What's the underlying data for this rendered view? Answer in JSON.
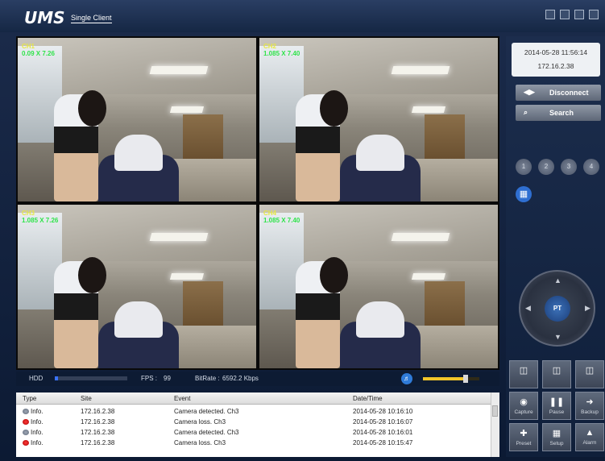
{
  "app": {
    "name": "UMS",
    "subtitle": "Single Client"
  },
  "tiles": [
    {
      "line1": "CH1",
      "line2": "0.09 X 7.26",
      "selected": true
    },
    {
      "line1": "CH2",
      "line2": "1.085 X 7.40",
      "selected": false
    },
    {
      "line1": "CH3",
      "line2": "1.085 X 7.26",
      "selected": false
    },
    {
      "line1": "CH4",
      "line2": "1.085 X 7.40",
      "selected": false
    }
  ],
  "status": {
    "hdd_label": "HDD",
    "hdd_fraction": 0.04,
    "fps_label": "FPS :",
    "fps_value": "99",
    "bitrate_label": "BitRate :",
    "bitrate_value": "6592.2 Kbps",
    "volume_fraction": 0.75
  },
  "log": {
    "headers": {
      "type": "Type",
      "site": "Site",
      "event": "Event",
      "datetime": "Date/Time"
    },
    "rows": [
      {
        "icon": "ok",
        "type": "Info.",
        "site": "172.16.2.38",
        "event": "Camera detected. Ch3",
        "datetime": "2014-05-28 10:16:10"
      },
      {
        "icon": "err",
        "type": "Info.",
        "site": "172.16.2.38",
        "event": "Camera loss. Ch3",
        "datetime": "2014-05-28 10:16:07"
      },
      {
        "icon": "ok",
        "type": "Info.",
        "site": "172.16.2.38",
        "event": "Camera detected. Ch3",
        "datetime": "2014-05-28 10:16:01"
      },
      {
        "icon": "err",
        "type": "Info.",
        "site": "172.16.2.38",
        "event": "Camera loss. Ch3",
        "datetime": "2014-05-28 10:15:47"
      }
    ]
  },
  "panel": {
    "datetime": "2014-05-28 11:56:14",
    "ip": "172.16.2.38",
    "disconnect_label": "Disconnect",
    "search_label": "Search",
    "channels": [
      "1",
      "2",
      "3",
      "4"
    ],
    "ptz_label": "PT",
    "tools_row1": [
      "",
      "",
      ""
    ],
    "tools_row2": [
      "Capture",
      "Pause",
      "Backup"
    ],
    "tools_row3": [
      "Preset",
      "Setup",
      "Alarm"
    ]
  }
}
